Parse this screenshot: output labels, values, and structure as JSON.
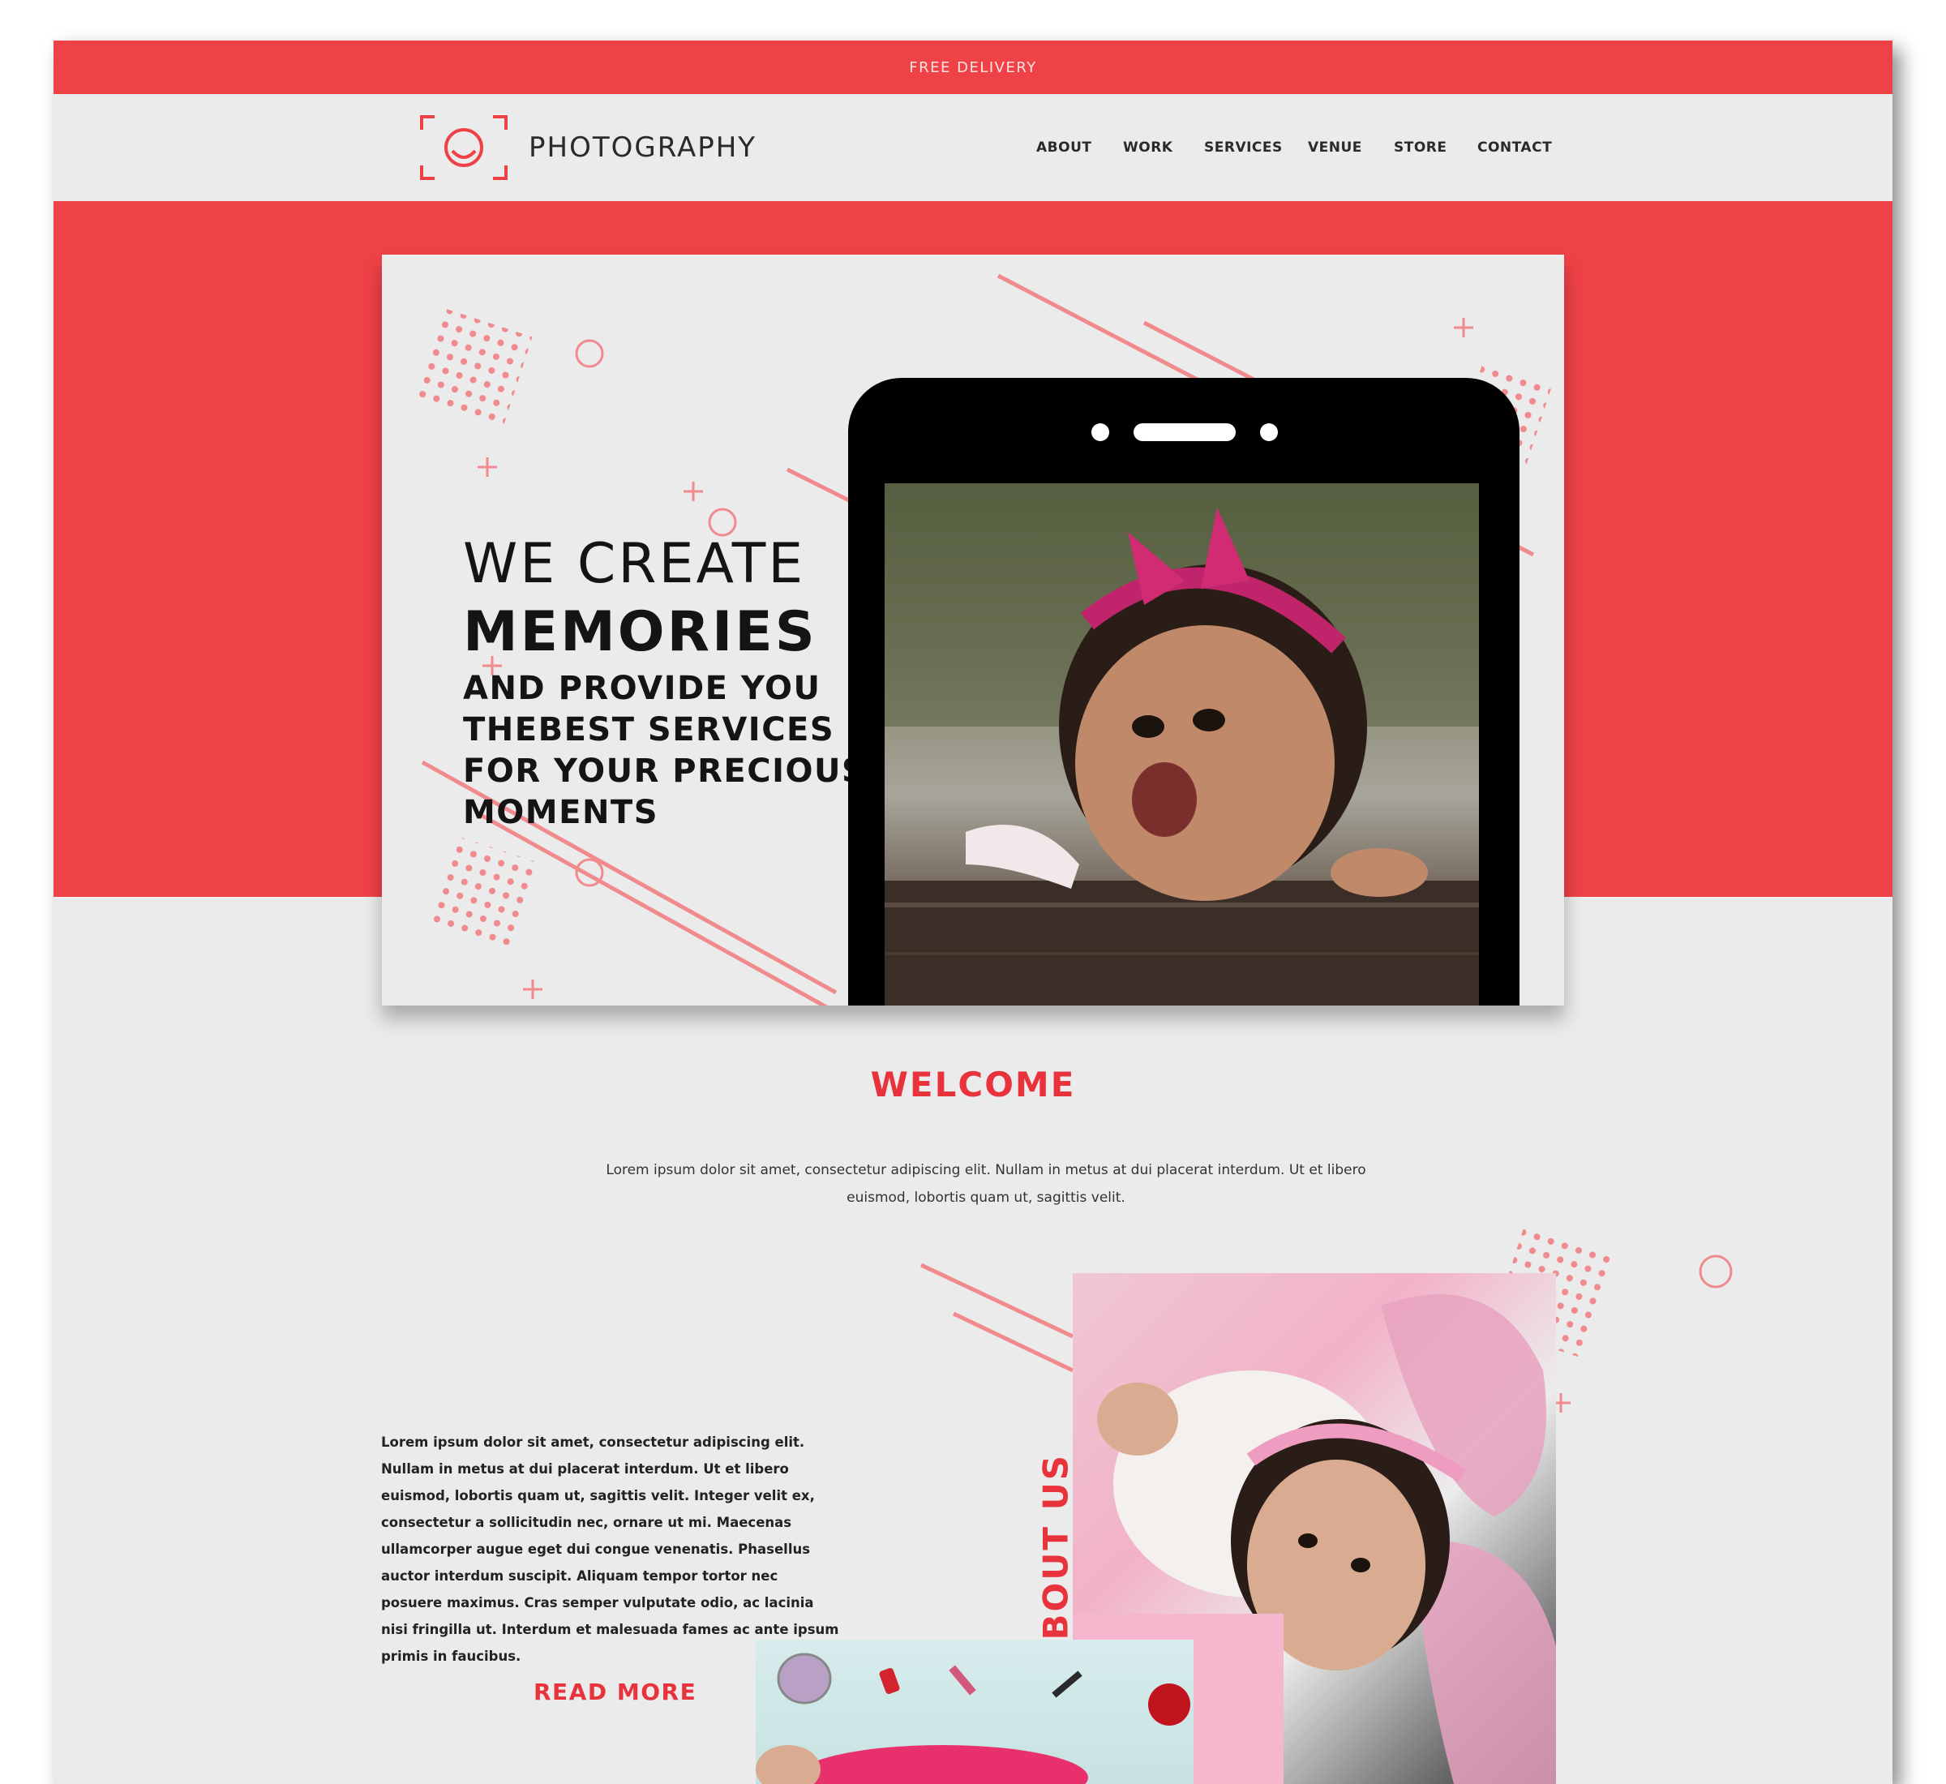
{
  "topbar": {
    "text": "FREE DELIVERY"
  },
  "brand": {
    "name": "PHOTOGRAPHY"
  },
  "nav": [
    {
      "label": "ABOUT"
    },
    {
      "label": "WORK"
    },
    {
      "label": "SERVICES"
    },
    {
      "label": "VENUE"
    },
    {
      "label": "STORE"
    },
    {
      "label": "CONTACT"
    }
  ],
  "hero": {
    "line1": "WE CREATE",
    "line2": "MEMORIES",
    "line3": "AND PROVIDE YOU",
    "line4": "THEBEST SERVICES",
    "line5": "FOR YOUR PRECIOUS",
    "line6": "MOMENTS"
  },
  "welcome": {
    "title": "WELCOME",
    "text": "Lorem ipsum dolor sit amet, consectetur adipiscing elit. Nullam in metus at dui placerat interdum. Ut et libero euismod, lobortis quam ut, sagittis velit."
  },
  "about": {
    "title": "ABOUT US",
    "body": "Lorem ipsum dolor sit amet, consectetur adipiscing elit. Nullam in metus at dui placerat interdum. Ut et libero euismod, lobortis quam ut, sagittis velit. Integer velit ex, consectetur a sollicitudin nec, ornare ut mi. Maecenas ullamcorper augue eget dui congue venenatis. Phasellus auctor interdum suscipit. Aliquam tempor tortor nec posuere maximus. Cras semper vulputate odio, ac lacinia nisi fringilla ut. Interdum et malesuada fames ac ante ipsum primis in faucibus.",
    "read_more": "READ MORE"
  },
  "colors": {
    "accent": "#ef4247",
    "accent_text": "#e8333c",
    "deco": "#f08a8d",
    "background": "#ebebeb"
  }
}
